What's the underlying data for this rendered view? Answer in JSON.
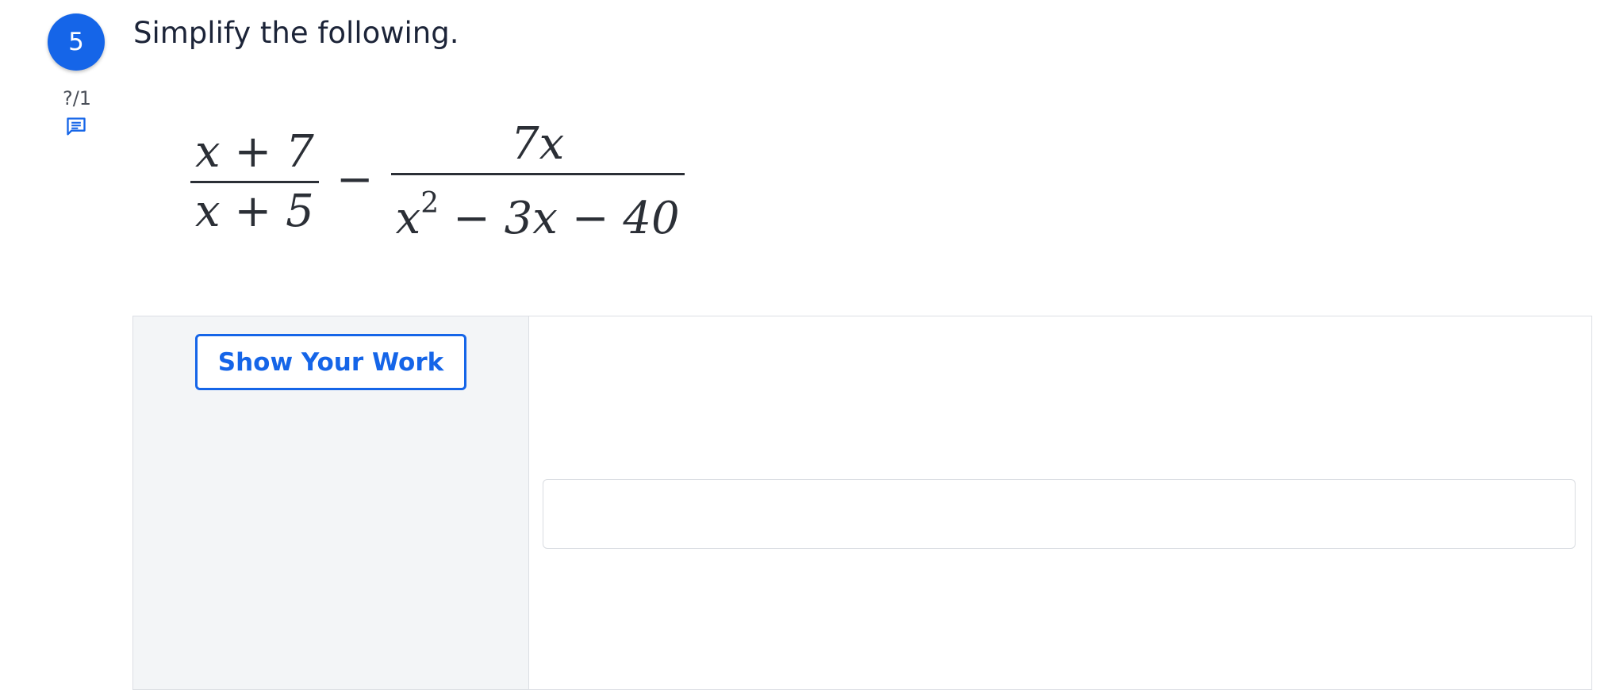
{
  "question": {
    "number": "5",
    "score": "?/1",
    "prompt": "Simplify the following."
  },
  "expression": {
    "term1": {
      "numerator": "x + 7",
      "denominator": "x + 5"
    },
    "operator": "−",
    "term2": {
      "numerator": "7x",
      "denominator": {
        "base": "x",
        "exponent": "2",
        "rest": " − 3x − 40"
      }
    }
  },
  "work_area": {
    "show_work_label": "Show Your Work",
    "answer_placeholder": ""
  },
  "colors": {
    "accent": "#1565e8",
    "panel_bg": "#f3f5f7",
    "text": "#1c2438"
  },
  "icons": {
    "comment": "comment-icon"
  }
}
